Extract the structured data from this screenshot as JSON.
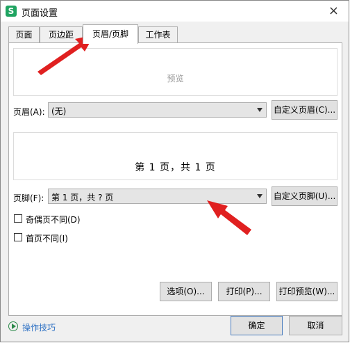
{
  "window": {
    "title": "页面设置",
    "close_glyph": "×"
  },
  "tabs": [
    {
      "label": "页面"
    },
    {
      "label": "页边距"
    },
    {
      "label": "页眉/页脚"
    },
    {
      "label": "工作表"
    }
  ],
  "header_preview": {
    "label": "预览"
  },
  "header": {
    "label": "页眉(A):",
    "value": "(无)",
    "custom_button": "自定义页眉(C)..."
  },
  "footer_preview": {
    "text": "第 1 页，共 1 页"
  },
  "footer": {
    "label": "页脚(F):",
    "value": "第 1 页，共 ? 页",
    "custom_button": "自定义页脚(U)..."
  },
  "options": {
    "odd_even_different": {
      "label": "奇偶页不同(D)",
      "checked": false
    },
    "first_page_different": {
      "label": "首页不同(I)",
      "checked": false
    }
  },
  "buttons": {
    "options": "选项(O)...",
    "print": "打印(P)...",
    "print_preview": "打印预览(W)..."
  },
  "footer_bar": {
    "tips": "操作技巧",
    "ok": "确定",
    "cancel": "取消"
  },
  "colors": {
    "app_icon": "#1fa461",
    "annotation_arrow": "#e02020",
    "link": "#2f72c4"
  }
}
